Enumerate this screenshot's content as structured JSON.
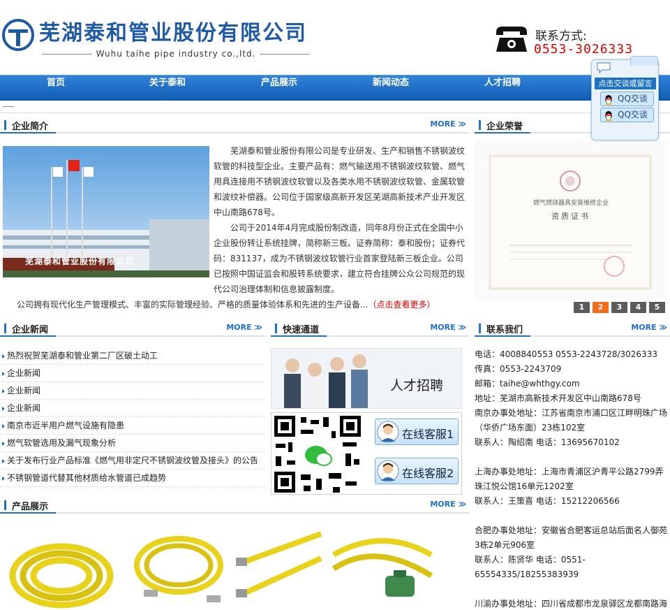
{
  "header": {
    "company_name": "芜湖泰和管业股份有限公司",
    "company_en": "Wuhu taihe pipe industry co.,ltd.",
    "contact_label": "联系方式:",
    "contact_phone": "0553-3026333"
  },
  "nav": {
    "items": [
      {
        "label": "首页"
      },
      {
        "label": "关于泰和"
      },
      {
        "label": "产品展示"
      },
      {
        "label": "新闻动态"
      },
      {
        "label": "人才招聘"
      }
    ]
  },
  "qq": {
    "message_label": "点击交谈或留言",
    "buttons": [
      "QQ交谈",
      "QQ交谈"
    ]
  },
  "sections": {
    "intro": {
      "title": "企业简介",
      "more": "MORE"
    },
    "honor": {
      "title": "企业荣誉"
    },
    "news": {
      "title": "企业新闻",
      "more": "MORE"
    },
    "quick": {
      "title": "快速通道",
      "more": "MORE"
    },
    "contact": {
      "title": "联系我们",
      "more": "MORE"
    },
    "products": {
      "title": "产品展示",
      "more": "MORE"
    }
  },
  "intro": {
    "p1": "芜湖泰和管业股份有限公司是专业研发、生产和销售不锈钢波纹软管的科技型企业。主要产品有：燃气输送用不锈钢波纹软管、燃气用具连接用不锈钢波纹软管以及各类水用不锈钢波纹软管、金属软管和波纹补偿器。公司位于国家级高新开发区芜湖高新技术产业开发区中山南路678号。",
    "p2": "公司于2014年4月完成股份制改造，同年8月份正式在全国中小企业股份转让系统挂牌，简称新三板。证券简称：泰和股份；证券代码：831137，成为不锈钢波纹软管行业首家登陆新三板企业。公司已按照中国证监会和股转系统要求，建立符合挂牌公众公司规范的现代公司治理体制和信息披露制度。",
    "p3": "公司拥有现代化生产管理模式、丰富的实际管理经验、严格的质量体验体系和先进的生产设备...",
    "more_link": "（点击查看更多）",
    "photo_sign": "芜湖泰和管业股份有限公司"
  },
  "honor": {
    "cert_heading": "燃气燃烧器具安装维修企业",
    "cert_title": "资质证书",
    "pages": [
      "1",
      "2",
      "3",
      "4",
      "5"
    ],
    "active_page": 2
  },
  "news": {
    "items": [
      "热烈祝贺芜湖泰和管业第二厂区破土动工",
      "企业新闻",
      "企业新闻",
      "企业新闻",
      "南京市近半用户燃气设施有隐患",
      "燃气软管选用及漏气现象分析",
      "关于发布行业产品标准《燃气用非定尺不锈钢波纹管及接头》的公告",
      "不锈钢管道代替其他材质给水管道已成趋势"
    ]
  },
  "quick": {
    "banner_caption": "人才招聘",
    "kf1": "在线客服1",
    "kf2": "在线客服2"
  },
  "contact": {
    "lines": [
      "电话：4008840553  0553-2243728/3026333",
      "传真：0553-2243709",
      "邮箱：taihe@whthgy.com",
      "地址：芜湖市高新技术开发区中山南路678号",
      "南京办事处地址：江苏省南京市浦口区江畔明珠广场（华侨广场东面）23栋102室",
      "联系人：陶绍南  电话：13695670102",
      "",
      "上海办事处地址：上海市青浦区沪青平公路2799弄珠江悦公馆16单元1202室",
      "联系人：王策喜  电话：15212206566",
      "",
      "合肥办事处地址：安徽省合肥客运总站后面名人御苑3栋2单元906室",
      "联系人：陈贤华 电话：0551-65554335/18255383939",
      "",
      "川渝办事处地址：四川省成都市龙泉驿区龙都南路海"
    ]
  },
  "colors": {
    "brand_blue": "#1e6fc6",
    "nav_blue": "#1466bd",
    "phone_red": "#e10000",
    "pager_active": "#f36d1c"
  }
}
